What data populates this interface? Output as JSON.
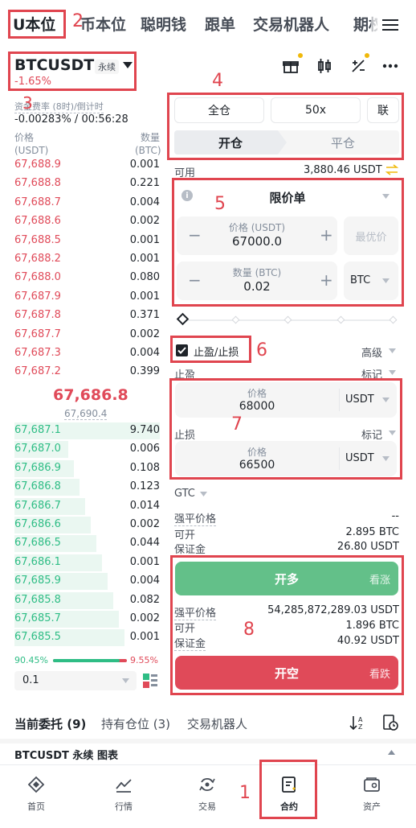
{
  "nav_tabs": [
    "U本位",
    "币本位",
    "聪明钱",
    "跟单",
    "交易机器人",
    "期权"
  ],
  "menu_icon": "menu-icon",
  "symbol": {
    "name": "BTCUSDT",
    "badge": "永续",
    "change": "-1.65%"
  },
  "header_icons": [
    "gift-icon",
    "candlestick-icon",
    "calculator-icon",
    "more-icon"
  ],
  "funding": {
    "label": "资金费率 (8时)/倒计时",
    "value": "-0.00283% / 00:56:28"
  },
  "book_headers": {
    "price": "价格",
    "price_unit": "(USDT)",
    "qty": "数量",
    "qty_unit": "(BTC)"
  },
  "asks": [
    {
      "p": "67,688.9",
      "q": "0.001"
    },
    {
      "p": "67,688.8",
      "q": "0.221"
    },
    {
      "p": "67,688.7",
      "q": "0.004"
    },
    {
      "p": "67,688.6",
      "q": "0.002"
    },
    {
      "p": "67,688.5",
      "q": "0.001"
    },
    {
      "p": "67,688.2",
      "q": "0.001"
    },
    {
      "p": "67,688.0",
      "q": "0.080"
    },
    {
      "p": "67,687.9",
      "q": "0.001"
    },
    {
      "p": "67,687.8",
      "q": "0.371"
    },
    {
      "p": "67,687.7",
      "q": "0.002"
    },
    {
      "p": "67,687.3",
      "q": "0.004"
    },
    {
      "p": "67,687.2",
      "q": "0.399"
    }
  ],
  "mid": {
    "last": "67,686.8",
    "mark": "67,690.4"
  },
  "bids": [
    {
      "p": "67,687.1",
      "q": "9.740"
    },
    {
      "p": "67,687.0",
      "q": "0.006"
    },
    {
      "p": "67,686.9",
      "q": "0.108"
    },
    {
      "p": "67,686.8",
      "q": "0.123"
    },
    {
      "p": "67,686.7",
      "q": "0.014"
    },
    {
      "p": "67,686.6",
      "q": "0.002"
    },
    {
      "p": "67,686.5",
      "q": "0.044"
    },
    {
      "p": "67,686.1",
      "q": "0.001"
    },
    {
      "p": "67,685.9",
      "q": "0.004"
    },
    {
      "p": "67,685.8",
      "q": "0.082"
    },
    {
      "p": "67,685.7",
      "q": "0.002"
    },
    {
      "p": "67,685.5",
      "q": "0.001"
    }
  ],
  "ratio": {
    "buy": "90.45%",
    "sell": "9.55%",
    "buy_fraction": 0.9045
  },
  "precision": "0.1",
  "margin": {
    "mode": "全仓",
    "leverage": "50x",
    "extra": "联"
  },
  "side_tabs": {
    "open": "开仓",
    "close": "平仓"
  },
  "available": {
    "label": "可用",
    "value": "3,880.46 USDT"
  },
  "order_type": "限价单",
  "price": {
    "label": "价格 (USDT)",
    "value": "67000.0",
    "best": "最优价"
  },
  "qty": {
    "label": "数量 (BTC)",
    "value": "0.02",
    "unit": "BTC"
  },
  "tpsl": {
    "label": "止盈/止损",
    "advanced": "高级",
    "tp": "止盈",
    "sl": "止损",
    "mark": "标记",
    "tp_price_label": "价格",
    "tp_price": "68000",
    "sl_price_label": "价格",
    "sl_price": "66500",
    "unit": "USDT"
  },
  "tif": "GTC",
  "long_info": {
    "liq_label": "强平价格",
    "liq": "--",
    "open_label": "可开",
    "open": "2.895 BTC",
    "margin_label": "保证金",
    "margin": "26.80 USDT"
  },
  "long_btn": {
    "label": "开多",
    "tag": "看涨"
  },
  "short_info": {
    "liq_label": "强平价格",
    "liq": "54,285,872,289.03 USDT",
    "open_label": "可开",
    "open": "1.896 BTC",
    "margin_label": "保证金",
    "margin": "40.92 USDT"
  },
  "short_btn": {
    "label": "开空",
    "tag": "看跌"
  },
  "bottom_tabs": [
    "当前委托 (9)",
    "持有仓位 (3)",
    "交易机器人"
  ],
  "chart_bar": "BTCUSDT 永续 图表",
  "bottom_nav": [
    {
      "label": "首页",
      "icon": "home-icon"
    },
    {
      "label": "行情",
      "icon": "market-icon"
    },
    {
      "label": "交易",
      "icon": "trade-icon"
    },
    {
      "label": "合约",
      "icon": "futures-icon"
    },
    {
      "label": "资产",
      "icon": "wallet-icon"
    }
  ],
  "annotations": [
    "1",
    "2",
    "3",
    "4",
    "5",
    "6",
    "7",
    "8"
  ],
  "colors": {
    "ask": "#e04a59",
    "bid": "#2ebd85",
    "buy": "#63c089",
    "sell": "#e04a59",
    "annotation": "#e0454f",
    "accent": "#f0b90b"
  }
}
